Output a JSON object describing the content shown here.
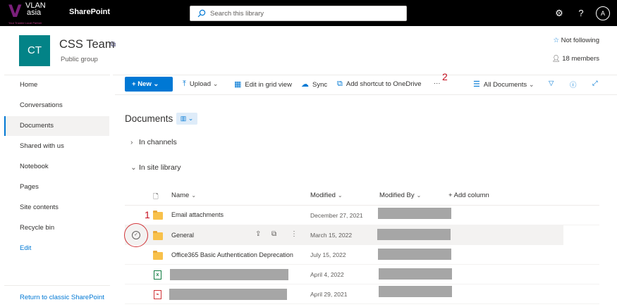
{
  "suitebar": {
    "logo_v": "V",
    "logo_line1": "VLAN",
    "logo_line2": "asia",
    "logo_tagline": "Your Trusted Local Partner",
    "app_name": "SharePoint",
    "search_placeholder": "Search this library",
    "settings_icon": "gear-icon",
    "help_icon": "question-icon",
    "avatar_initial": "A"
  },
  "site": {
    "logo_initials": "CT",
    "title": "CSS Team",
    "subtitle": "Public group",
    "follow_label": "Not following",
    "members_label": "18 members"
  },
  "nav": {
    "items": [
      "Home",
      "Conversations",
      "Documents",
      "Shared with us",
      "Notebook",
      "Pages",
      "Site contents",
      "Recycle bin",
      "Edit"
    ],
    "active": "Documents",
    "return_link": "Return to classic SharePoint"
  },
  "commands": {
    "new": "New",
    "upload": "Upload",
    "edit_grid": "Edit in grid view",
    "sync": "Sync",
    "shortcut": "Add shortcut to OneDrive",
    "more": "···",
    "view": "All Documents"
  },
  "annotations": {
    "mark_1": "1",
    "mark_2": "2"
  },
  "library": {
    "title": "Documents",
    "sections": [
      "In channels",
      "In site library"
    ]
  },
  "table": {
    "columns": [
      "Name",
      "Modified",
      "Modified By",
      "+ Add column"
    ],
    "rows": [
      {
        "type": "folder",
        "name": "Email attachments",
        "modified": "December 27, 2021"
      },
      {
        "type": "folder",
        "name": "General",
        "modified": "March 15, 2022"
      },
      {
        "type": "folder",
        "name": "Office365 Basic Authentication Deprecation",
        "modified": "July 15, 2022"
      },
      {
        "type": "excel",
        "name": "",
        "modified": "April 4, 2022"
      },
      {
        "type": "pdf",
        "name": "",
        "modified": "April 29, 2021"
      }
    ]
  },
  "colors": {
    "accent": "#0078d4",
    "site_logo": "#038387",
    "folder": "#f8c14b",
    "annotation_red": "#c50f1f"
  }
}
